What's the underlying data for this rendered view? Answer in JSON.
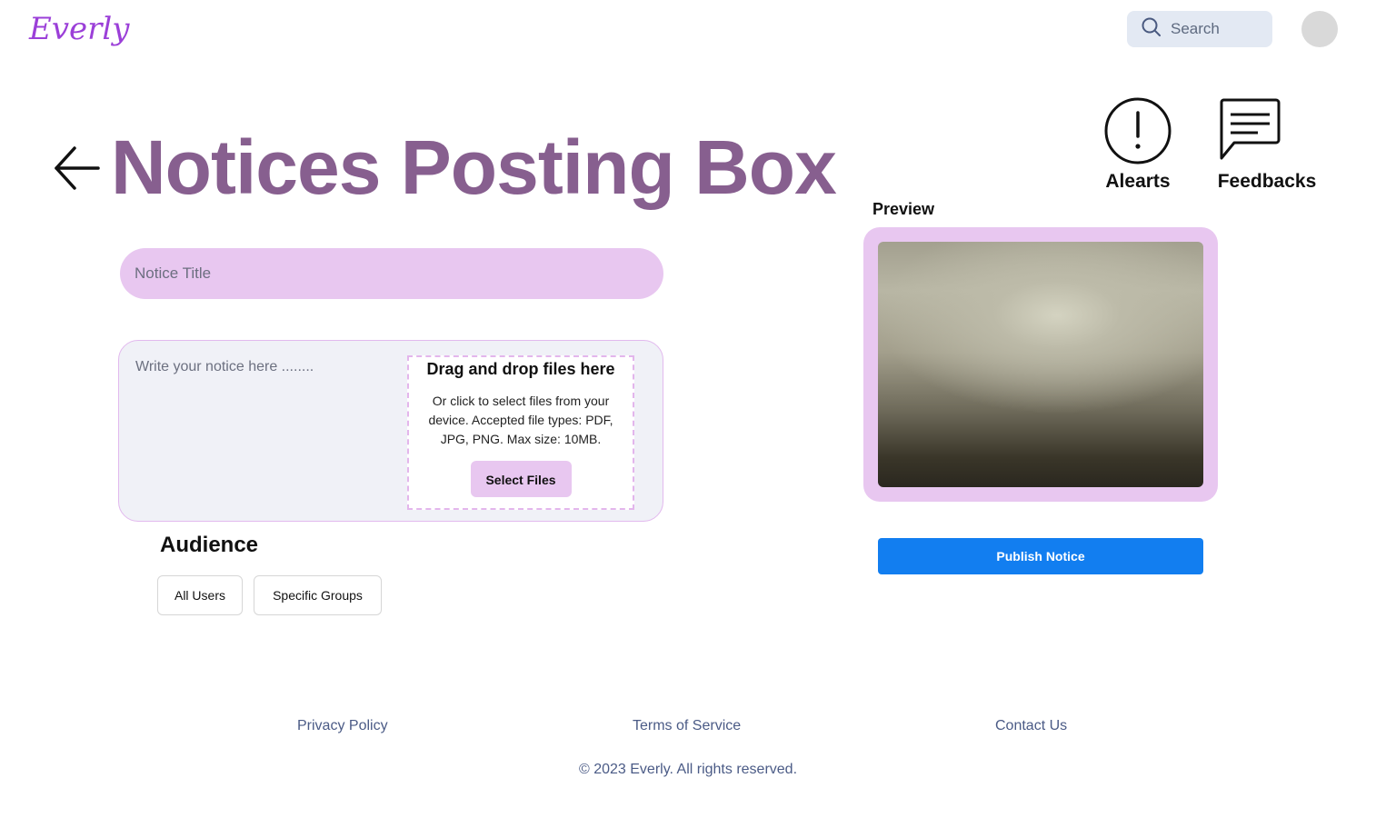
{
  "header": {
    "logo": "Everly",
    "search_placeholder": "Search",
    "search_icon": "search-icon",
    "avatar_icon": "avatar"
  },
  "page": {
    "title": "Notices Posting Box",
    "back_icon": "arrow-left-icon"
  },
  "nav": {
    "alerts_label": "Alearts",
    "alerts_icon": "alert-circle-icon",
    "feedbacks_label": "Feedbacks",
    "feedbacks_icon": "message-square-icon"
  },
  "form": {
    "title_placeholder": "Notice Title",
    "body_placeholder": "Write your notice here ........",
    "dropzone_title": "Drag and drop files here",
    "dropzone_text": "Or click to select files from your device. Accepted file types: PDF, JPG, PNG. Max size: 10MB.",
    "select_files_label": "Select Files"
  },
  "audience": {
    "heading": "Audience",
    "options": [
      "All Users",
      "Specific Groups"
    ]
  },
  "preview": {
    "label": "Preview",
    "publish_label": "Publish Notice"
  },
  "footer": {
    "links": [
      "Privacy Policy",
      "Terms of Service",
      "Contact Us"
    ],
    "copyright": "© 2023 Everly. All rights reserved."
  },
  "colors": {
    "accent": "#875f8f",
    "brand": "#9b3fd8",
    "lavender": "#e8c7f0",
    "primary_button": "#127ef0",
    "footer_link": "#4b5b86"
  }
}
